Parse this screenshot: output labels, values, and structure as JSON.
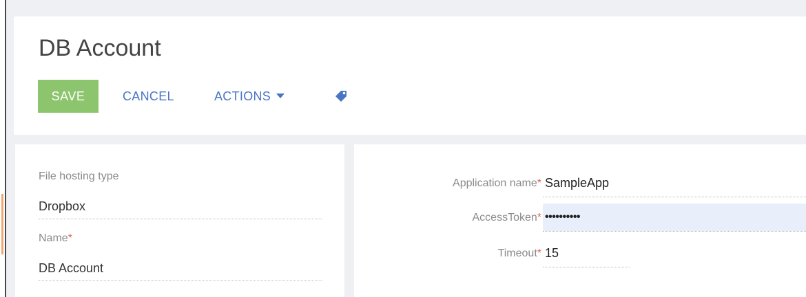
{
  "page": {
    "title": "DB Account"
  },
  "toolbar": {
    "save_label": "SAVE",
    "cancel_label": "CANCEL",
    "actions_label": "ACTIONS"
  },
  "left_panel": {
    "file_hosting_type": {
      "label": "File hosting type",
      "value": "Dropbox"
    },
    "name": {
      "label": "Name",
      "required_mark": "*",
      "value": "DB Account"
    }
  },
  "right_panel": {
    "application_name": {
      "label": "Application name",
      "required_mark": "*",
      "value": "SampleApp"
    },
    "access_token": {
      "label": "AccessToken",
      "required_mark": "*",
      "value": "••••••••••"
    },
    "timeout": {
      "label": "Timeout",
      "required_mark": "*",
      "value": "15"
    }
  },
  "colors": {
    "save_button": "#8cc56d",
    "link": "#4a75c2",
    "required": "#e06a4f",
    "focused_field": "#e8eefa"
  },
  "icons": {
    "tag": "tag-icon",
    "dropdown": "caret-down-icon"
  }
}
